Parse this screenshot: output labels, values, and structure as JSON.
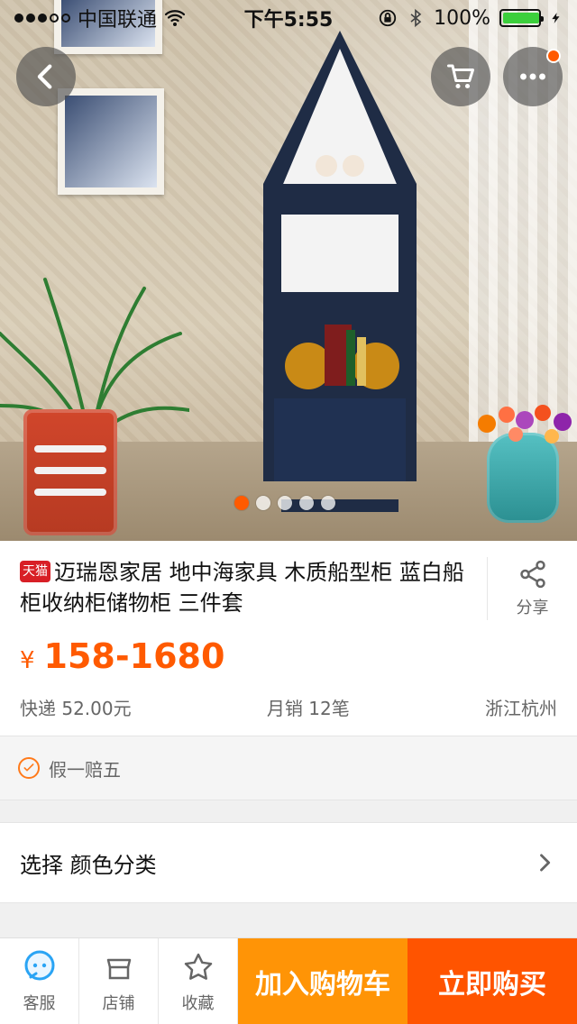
{
  "status_bar": {
    "carrier": "中国联通",
    "time": "下午5:55",
    "battery_percent": "100%",
    "battery_level": 1.0
  },
  "overlay_buttons": {
    "back_icon": "chevron-left-icon",
    "cart_icon": "cart-icon",
    "more_icon": "more-dots-icon",
    "has_notification": true
  },
  "carousel": {
    "total": 5,
    "active_index": 0
  },
  "product": {
    "badge": "天猫",
    "title": "迈瑞恩家居 地中海家具 木质船型柜 蓝白船柜收纳柜储物柜 三件套",
    "share_label": "分享",
    "currency": "¥",
    "price_range": "158-1680",
    "shipping": "快递 52.00元",
    "monthly_sales": "月销 12笔",
    "location": "浙江杭州"
  },
  "guarantee": {
    "label": "假一赔五"
  },
  "select": {
    "label": "选择 颜色分类"
  },
  "bottom_bar": {
    "tabs": [
      {
        "label": "客服",
        "icon": "chat-bubble-icon"
      },
      {
        "label": "店铺",
        "icon": "store-icon"
      },
      {
        "label": "收藏",
        "icon": "star-icon"
      }
    ],
    "add_to_cart": "加入购物车",
    "buy_now": "立即购买"
  },
  "colors": {
    "accent_orange": "#ff5a00",
    "cart_orange": "#ff9406",
    "buy_orange": "#ff5400",
    "tmall_red": "#d81f26"
  }
}
